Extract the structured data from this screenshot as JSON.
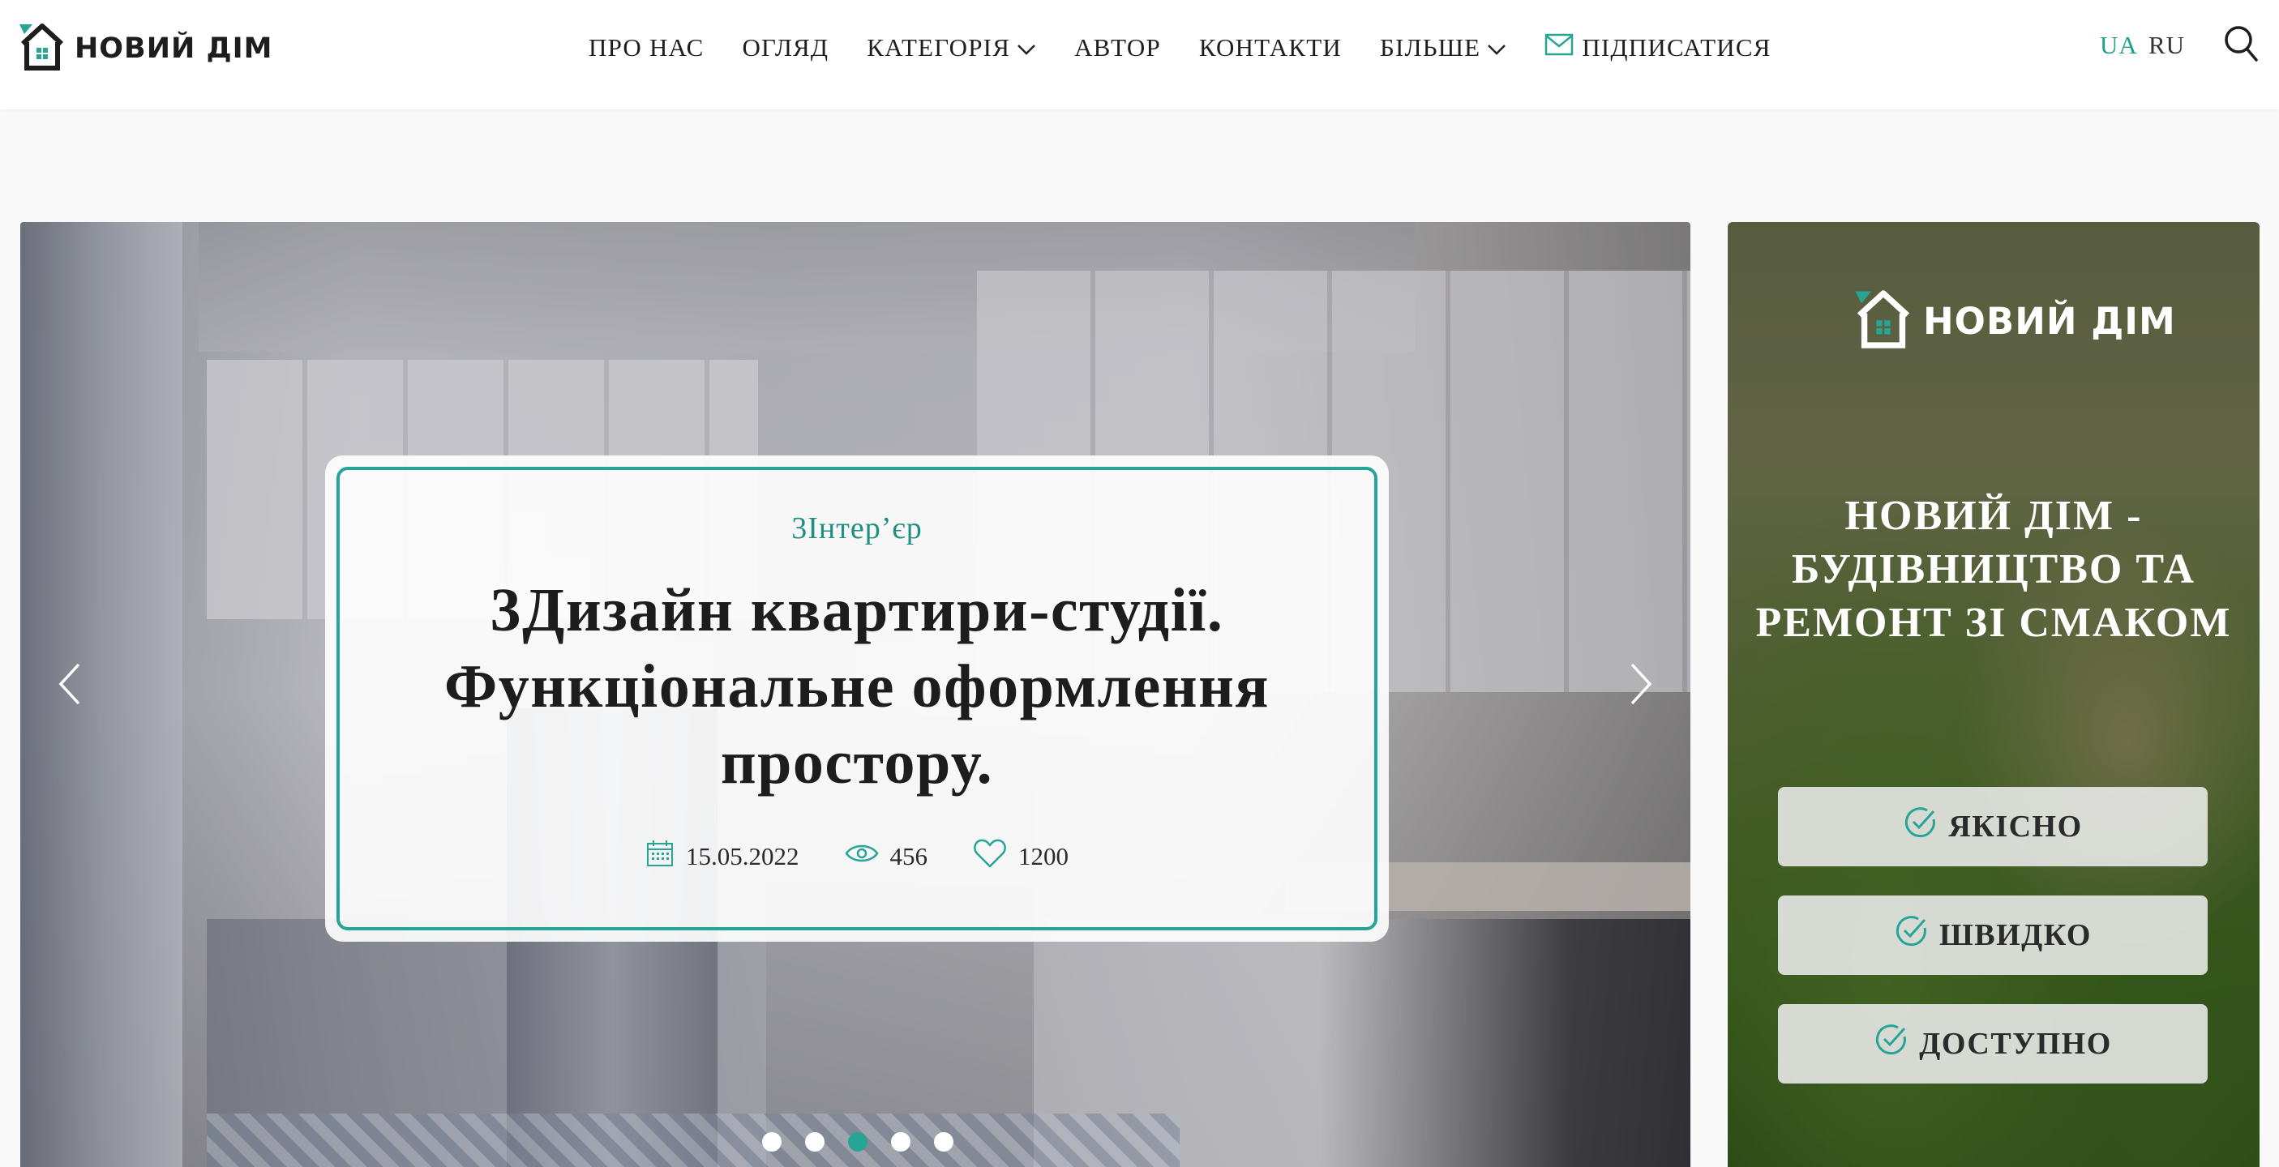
{
  "brand": {
    "name": "НОВИЙ ДІМ",
    "accent": "#26a597"
  },
  "nav": {
    "items": [
      {
        "label": "ПРО НАС"
      },
      {
        "label": "ОГЛЯД"
      },
      {
        "label": "КАТЕГОРІЯ",
        "dropdown": true
      },
      {
        "label": "АВТОР"
      },
      {
        "label": "КОНТАКТИ"
      },
      {
        "label": "БІЛЬШЕ",
        "dropdown": true
      }
    ],
    "subscribe": "ПІДПИСАТИСЯ",
    "languages": {
      "ua": "UA",
      "ru": "RU",
      "active": "UA"
    }
  },
  "slider": {
    "category": "3Інтер’єр",
    "title_line1": "3Дизайн квартири-студії.",
    "title_line2": "Функціональне оформлення",
    "title_line3": "простору.",
    "date": "15.05.2022",
    "views": "456",
    "likes": "1200",
    "dots_count": 5,
    "active_dot": 3
  },
  "promo": {
    "logo_text": "НОВИЙ ДІМ",
    "title_line1": "НОВИЙ ДІМ -",
    "title_line2": "БУДІВНИЦТВО ТА",
    "title_line3": "РЕМОНТ ЗІ СМАКОМ",
    "buttons": [
      "ЯКІСНО",
      "ШВИДКО",
      "ДОСТУПНО"
    ]
  },
  "icons": [
    "house-logo-icon",
    "chevron-down-icon",
    "mail-icon",
    "search-icon",
    "arrow-left-icon",
    "arrow-right-icon",
    "calendar-icon",
    "eye-icon",
    "heart-icon",
    "check-circle-icon"
  ]
}
